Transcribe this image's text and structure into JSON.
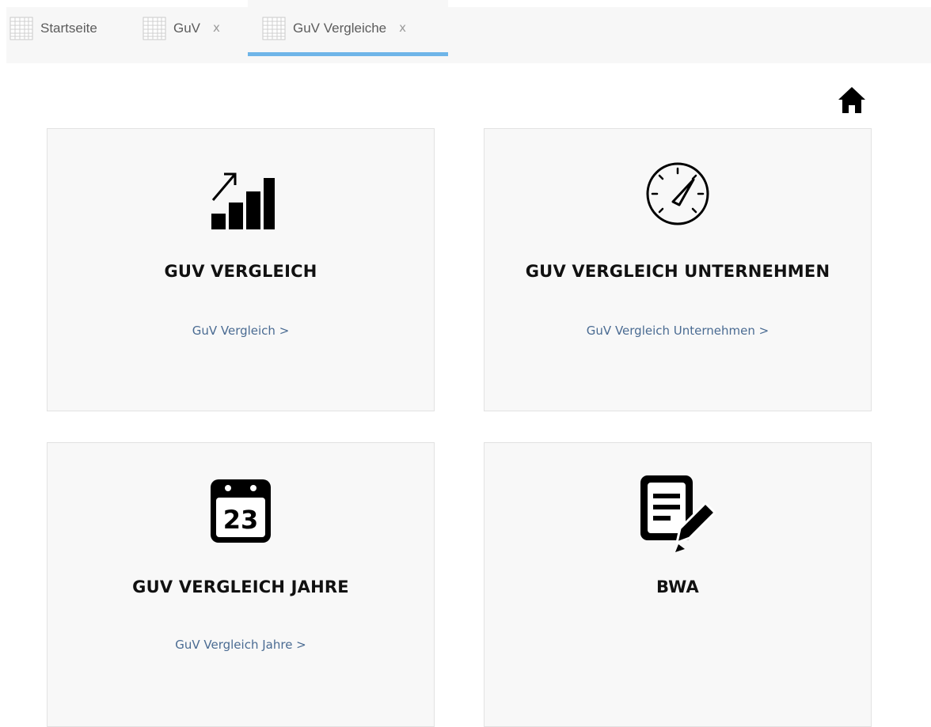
{
  "tabs": [
    {
      "label": "Startseite",
      "icon": "grid-icon",
      "closable": false,
      "active": false
    },
    {
      "label": "GuV",
      "icon": "grid-icon",
      "closable": true,
      "close_label": "x",
      "active": false
    },
    {
      "label": "GuV Vergleiche",
      "icon": "grid-icon",
      "closable": true,
      "close_label": "x",
      "active": true
    }
  ],
  "colors": {
    "tab_active_underline": "#6fb5e8",
    "link": "#4a6b92",
    "card_background": "#f8f8f8",
    "title": "#111111"
  },
  "home": {
    "icon": "home-icon"
  },
  "cards": [
    {
      "title": "GUV VERGLEICH",
      "link": "GuV Vergleich >",
      "icon": "chart-growth-icon"
    },
    {
      "title": "GUV VERGLEICH UNTERNEHMEN",
      "link": "GuV Vergleich Unternehmen >",
      "icon": "speedometer-icon"
    },
    {
      "title": "GUV VERGLEICH JAHRE",
      "link": "GuV Vergleich Jahre >",
      "icon": "calendar-icon",
      "icon_text": "23"
    },
    {
      "title": "BWA",
      "link": "",
      "icon": "document-edit-icon"
    }
  ]
}
